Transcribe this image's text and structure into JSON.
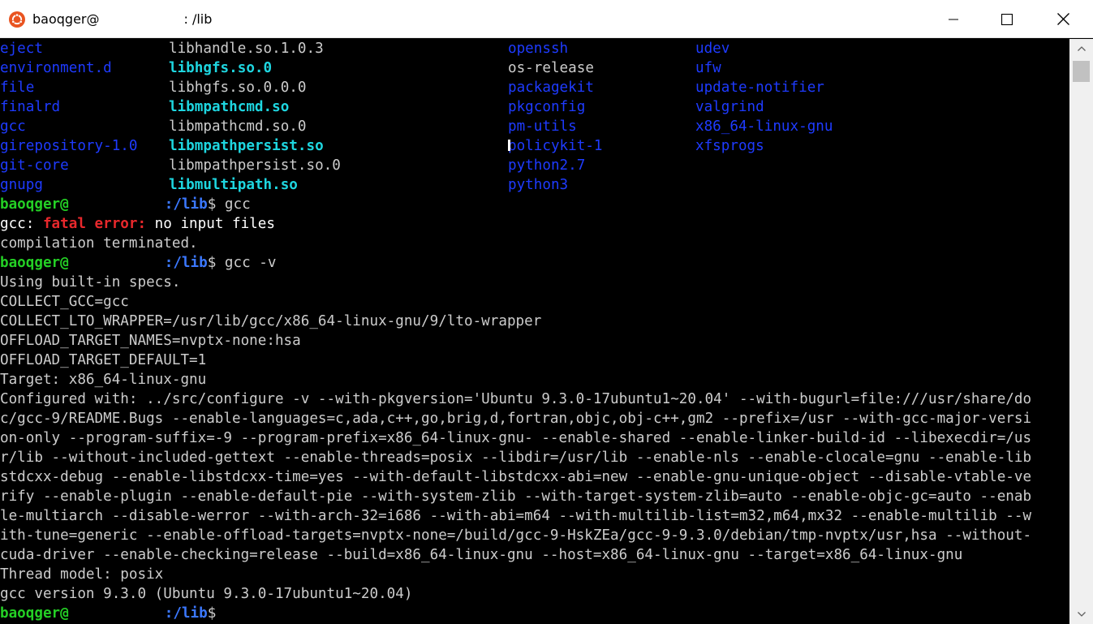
{
  "window": {
    "title_user": "baoqger@",
    "title_path": ": /lib",
    "controls": {
      "minimize": "minimize",
      "maximize": "maximize",
      "close": "close"
    },
    "icon": "ubuntu-icon"
  },
  "listing": {
    "col1": [
      "eject",
      "environment.d",
      "file",
      "finalrd",
      "gcc",
      "girepository-1.0",
      "git-core",
      "gnupg"
    ],
    "col2": [
      "libhandle.so.1.0.3",
      "libhgfs.so.0",
      "libhgfs.so.0.0.0",
      "libmpathcmd.so",
      "libmpathcmd.so.0",
      "libmpathpersist.so",
      "libmpathpersist.so.0",
      "libmultipath.so"
    ],
    "col3": [
      "openssh",
      "os-release",
      "packagekit",
      "pkgconfig",
      "pm-utils",
      "policykit-1",
      "python2.7",
      "python3"
    ],
    "col4": [
      "udev",
      "ufw",
      "update-notifier",
      "valgrind",
      "x86_64-linux-gnu",
      "xfsprogs"
    ]
  },
  "prompt": {
    "user": "baoqger@",
    "path": ":/lib",
    "dollar": "$"
  },
  "session": {
    "cmd1": " gcc",
    "err_prefix": "gcc: ",
    "err_label": "fatal error:",
    "err_msg": " no input files",
    "terminated": "compilation terminated.",
    "cmd2": " gcc -v",
    "output": [
      "Using built-in specs.",
      "COLLECT_GCC=gcc",
      "COLLECT_LTO_WRAPPER=/usr/lib/gcc/x86_64-linux-gnu/9/lto-wrapper",
      "OFFLOAD_TARGET_NAMES=nvptx-none:hsa",
      "OFFLOAD_TARGET_DEFAULT=1",
      "Target: x86_64-linux-gnu",
      "Configured with: ../src/configure -v --with-pkgversion='Ubuntu 9.3.0-17ubuntu1~20.04' --with-bugurl=file:///usr/share/do",
      "c/gcc-9/README.Bugs --enable-languages=c,ada,c++,go,brig,d,fortran,objc,obj-c++,gm2 --prefix=/usr --with-gcc-major-versi",
      "on-only --program-suffix=-9 --program-prefix=x86_64-linux-gnu- --enable-shared --enable-linker-build-id --libexecdir=/us",
      "r/lib --without-included-gettext --enable-threads=posix --libdir=/usr/lib --enable-nls --enable-clocale=gnu --enable-lib",
      "stdcxx-debug --enable-libstdcxx-time=yes --with-default-libstdcxx-abi=new --enable-gnu-unique-object --disable-vtable-ve",
      "rify --enable-plugin --enable-default-pie --with-system-zlib --with-target-system-zlib=auto --enable-objc-gc=auto --enab",
      "le-multiarch --disable-werror --with-arch-32=i686 --with-abi=m64 --with-multilib-list=m32,m64,mx32 --enable-multilib --w",
      "ith-tune=generic --enable-offload-targets=nvptx-none=/build/gcc-9-HskZEa/gcc-9-9.3.0/debian/tmp-nvptx/usr,hsa --without-",
      "cuda-driver --enable-checking=release --build=x86_64-linux-gnu --host=x86_64-linux-gnu --target=x86_64-linux-gnu",
      "Thread model: posix",
      "gcc version 9.3.0 (Ubuntu 9.3.0-17ubuntu1~20.04)"
    ]
  },
  "colors": {
    "directory": "#1e3bff",
    "symlink": "#1ed6e0",
    "prompt_user": "#24d025",
    "prompt_path": "#3b78ff",
    "error": "#e8282c",
    "text": "#cccccc"
  }
}
